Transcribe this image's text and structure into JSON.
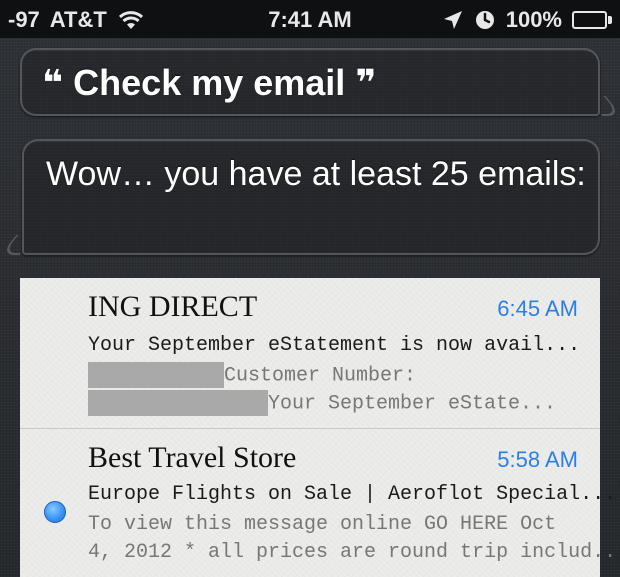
{
  "status_bar": {
    "signal": "-97",
    "carrier": "AT&T",
    "time": "7:41 AM",
    "battery": "100%",
    "icons": [
      "wifi-icon",
      "location-arrow-icon",
      "clock-icon",
      "battery-icon"
    ]
  },
  "user_query": {
    "open_quote": "❝",
    "text": "Check my email",
    "close_quote": "❞"
  },
  "siri_response": {
    "text": "Wow… you have at least 25 emails:"
  },
  "emails": [
    {
      "sender": "ING DIRECT",
      "time": "6:45 AM",
      "subject": "Your September eStatement is now avail...",
      "preview_line1": "Customer Number:",
      "preview_line2": "Your September eState...",
      "unread": false
    },
    {
      "sender": "Best Travel Store",
      "time": "5:58 AM",
      "subject": "Europe Flights on Sale | Aeroflot Special...",
      "preview_line1": "To view this message online GO HERE Oct",
      "preview_line2": "4, 2012 * all prices are round trip includ...",
      "unread": true
    }
  ],
  "colors": {
    "time_blue": "#2a7fe6",
    "unread_dot": "#3b95f3",
    "card_bg": "#ececea"
  }
}
